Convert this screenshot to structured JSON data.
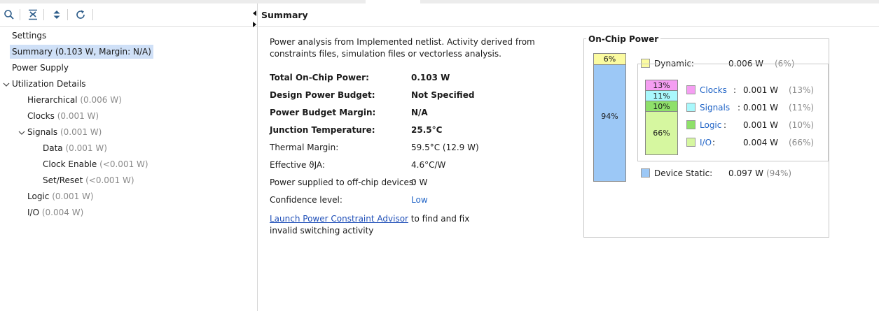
{
  "toolbar": {
    "search_icon": "search-icon",
    "collapse_all_icon": "collapse-all-icon",
    "expand_all_icon": "expand-all-icon",
    "refresh_icon": "refresh-icon"
  },
  "tree": {
    "settings": "Settings",
    "summary": {
      "label": "Summary",
      "value": "(0.103 W, Margin: N/A)"
    },
    "power_supply": "Power Supply",
    "utilization": "Utilization Details",
    "hierarchical": {
      "label": "Hierarchical",
      "value": "(0.006 W)"
    },
    "clocks": {
      "label": "Clocks",
      "value": "(0.001 W)"
    },
    "signals": {
      "label": "Signals",
      "value": "(0.001 W)"
    },
    "data": {
      "label": "Data",
      "value": "(0.001 W)"
    },
    "clock_enable": {
      "label": "Clock Enable",
      "value": "(<0.001 W)"
    },
    "set_reset": {
      "label": "Set/Reset",
      "value": "(<0.001 W)"
    },
    "logic": {
      "label": "Logic",
      "value": "(0.001 W)"
    },
    "io": {
      "label": "I/O",
      "value": "(0.004 W)"
    }
  },
  "panel": {
    "title": "Summary",
    "description": "Power analysis from Implemented netlist. Activity derived from constraints files, simulation files or vectorless analysis.",
    "properties": [
      {
        "label": "Total On-Chip Power:",
        "value": "0.103 W"
      },
      {
        "label": "Design Power Budget:",
        "value": "Not Specified"
      },
      {
        "label": "Power Budget Margin:",
        "value": "N/A"
      },
      {
        "label": "Junction Temperature:",
        "value": "25.5°C"
      },
      {
        "label": "Thermal Margin:",
        "value": "59.5°C (12.9 W)"
      },
      {
        "label": "Effective ϑJA:",
        "value": "4.6°C/W"
      },
      {
        "label": "Power supplied to off-chip devices:",
        "value": "0 W"
      },
      {
        "label": "Confidence level:",
        "value": "Low"
      }
    ],
    "advisor_link": "Launch Power Constraint Advisor",
    "advisor_text_1": " to find and fix",
    "advisor_text_2": "invalid switching activity"
  },
  "on_chip_power": {
    "title": "On-Chip Power",
    "big_bar": {
      "dynamic_pct_label": "6%",
      "static_pct_label": "94%",
      "dynamic_fraction": 0.06
    },
    "small_bar": [
      {
        "pct_label": "13%",
        "fraction": 0.13,
        "color": "#f59ef2"
      },
      {
        "pct_label": "11%",
        "fraction": 0.11,
        "color": "#a9f8fc"
      },
      {
        "pct_label": "10%",
        "fraction": 0.1,
        "color": "#8ee06a"
      },
      {
        "pct_label": "66%",
        "fraction": 0.66,
        "color": "#d6f7a0"
      }
    ],
    "dynamic": {
      "label": "Dynamic:",
      "value": "0.006 W",
      "pct": "(6%)",
      "color": "#fbfba0"
    },
    "clocks": {
      "label": "Clocks",
      "value": "0.001 W",
      "pct": "(13%)",
      "color": "#f59ef2"
    },
    "signals": {
      "label": "Signals",
      "value": "0.001 W",
      "pct": "(11%)",
      "color": "#a9f8fc"
    },
    "logic": {
      "label": "Logic",
      "value": "0.001 W",
      "pct": "(10%)",
      "color": "#8ee06a"
    },
    "io": {
      "label": "I/O",
      "value": "0.004 W",
      "pct": "(66%)",
      "color": "#d6f7a0"
    },
    "device_static": {
      "label": "Device Static:",
      "value": "0.097 W",
      "pct": "(94%)",
      "color": "#9cc8f6"
    }
  }
}
